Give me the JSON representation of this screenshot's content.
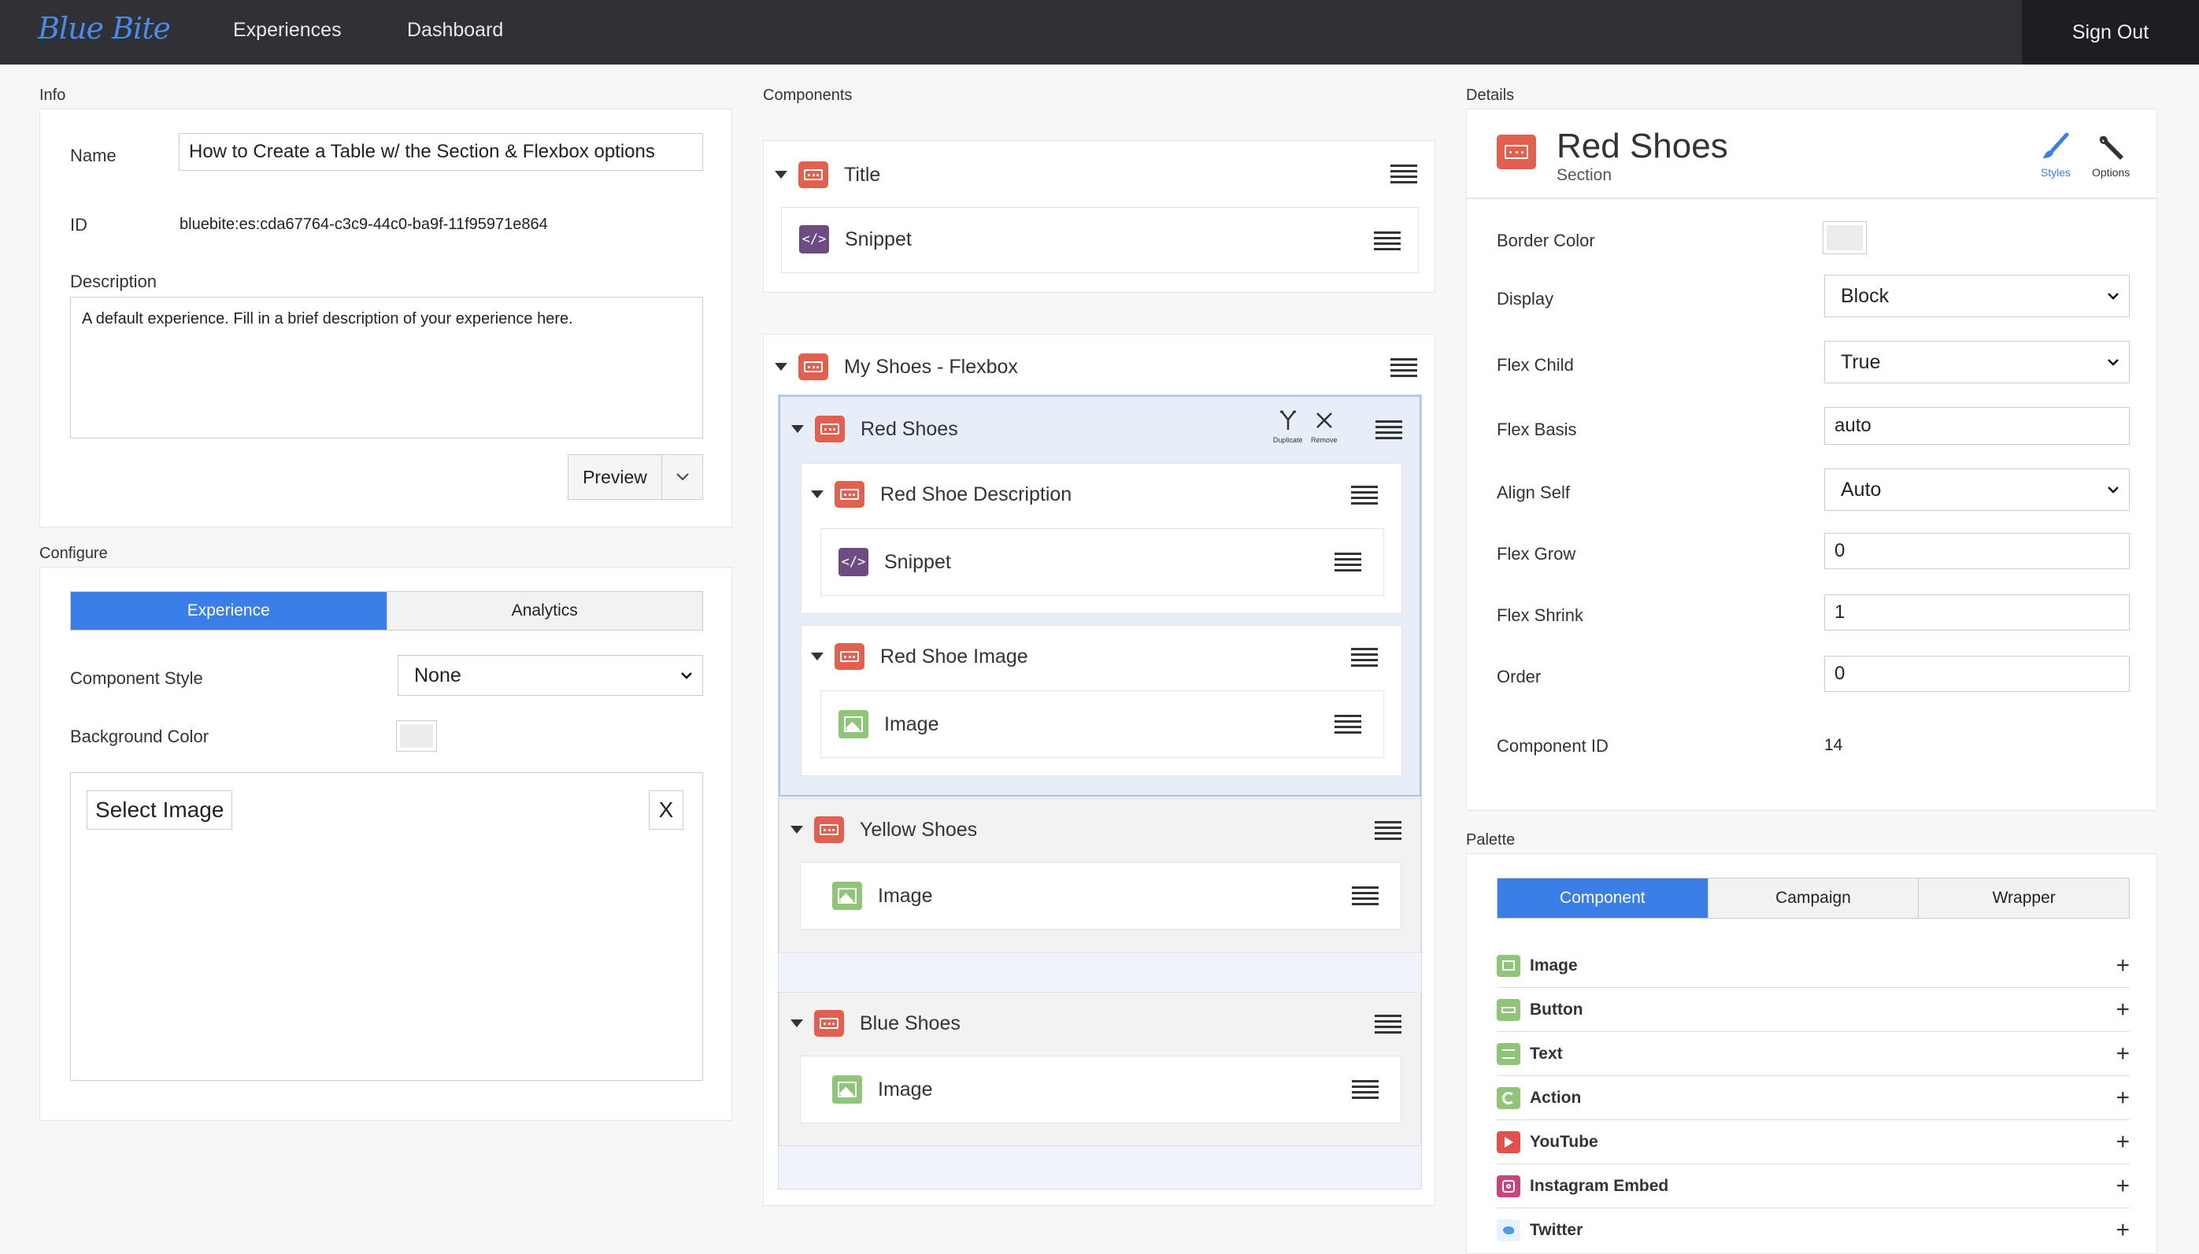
{
  "topbar": {
    "logo": "Blue Bite",
    "nav": [
      "Experiences",
      "Dashboard"
    ],
    "sign_out": "Sign Out"
  },
  "info": {
    "section_label": "Info",
    "name_label": "Name",
    "name_value": "How to Create a Table w/ the Section & Flexbox options",
    "id_label": "ID",
    "id_value": "bluebite:es:cda67764-c3c9-44c0-ba9f-11f95971e864",
    "description_label": "Description",
    "description_value": "A default experience. Fill in a brief description of your experience here.",
    "preview_label": "Preview"
  },
  "configure": {
    "section_label": "Configure",
    "tabs": [
      "Experience",
      "Analytics"
    ],
    "component_style_label": "Component Style",
    "component_style_value": "None",
    "background_color_label": "Background Color",
    "select_image_label": "Select Image",
    "clear_label": "X"
  },
  "components": {
    "section_label": "Components",
    "title_section": "Title",
    "title_snippet": "Snippet",
    "flexbox_section": "My Shoes - Flexbox",
    "red_shoes": "Red Shoes",
    "duplicate_label": "Duplicate",
    "remove_label": "Remove",
    "red_shoe_description": "Red Shoe Description",
    "red_shoe_description_snippet": "Snippet",
    "red_shoe_image": "Red Shoe Image",
    "red_shoe_image_child": "Image",
    "yellow_shoes": "Yellow Shoes",
    "yellow_shoes_image": "Image",
    "blue_shoes": "Blue Shoes",
    "blue_shoes_image": "Image"
  },
  "details": {
    "section_label": "Details",
    "title": "Red Shoes",
    "subtitle": "Section",
    "tools": [
      "Styles",
      "Options"
    ],
    "fields": {
      "border_color_label": "Border Color",
      "display_label": "Display",
      "display_value": "Block",
      "flex_child_label": "Flex Child",
      "flex_child_value": "True",
      "flex_basis_label": "Flex Basis",
      "flex_basis_value": "auto",
      "align_self_label": "Align Self",
      "align_self_value": "Auto",
      "flex_grow_label": "Flex Grow",
      "flex_grow_value": "0",
      "flex_shrink_label": "Flex Shrink",
      "flex_shrink_value": "1",
      "order_label": "Order",
      "order_value": "0",
      "component_id_label": "Component ID",
      "component_id_value": "14"
    }
  },
  "palette": {
    "section_label": "Palette",
    "tabs": [
      "Component",
      "Campaign",
      "Wrapper"
    ],
    "items": [
      {
        "label": "Image",
        "icon": "image-icon",
        "color": "#8fc578"
      },
      {
        "label": "Button",
        "icon": "button-icon",
        "color": "#8fc578"
      },
      {
        "label": "Text",
        "icon": "text-icon",
        "color": "#8fc578"
      },
      {
        "label": "Action",
        "icon": "action-icon",
        "color": "#8fc578"
      },
      {
        "label": "YouTube",
        "icon": "youtube-icon",
        "color": "#e2524a"
      },
      {
        "label": "Instagram Embed",
        "icon": "instagram-icon",
        "color": "#c9437e"
      },
      {
        "label": "Twitter",
        "icon": "twitter-icon",
        "color": "#4a9ae8"
      }
    ]
  },
  "colors": {
    "accent": "#3a7ee8",
    "section_icon": "#e2604f",
    "snippet_icon": "#6d4c82",
    "image_icon": "#8fc578",
    "topbar": "#2f3136"
  }
}
